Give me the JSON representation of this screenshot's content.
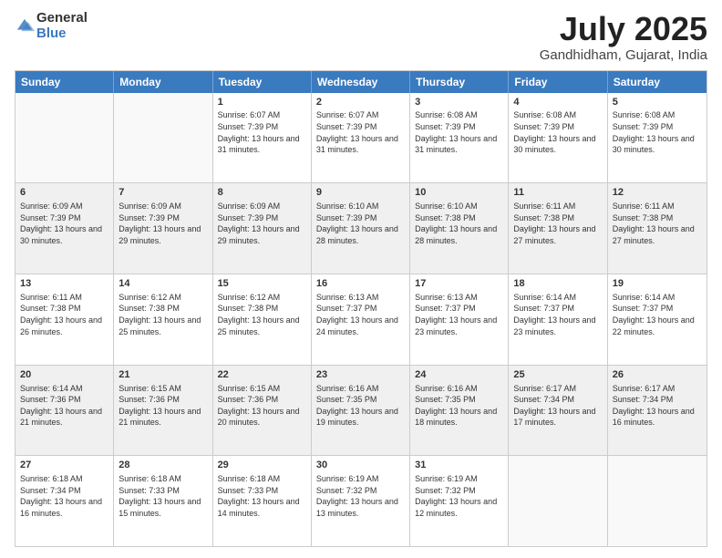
{
  "header": {
    "logo_general": "General",
    "logo_blue": "Blue",
    "title_month": "July 2025",
    "title_location": "Gandhidham, Gujarat, India"
  },
  "days_of_week": [
    "Sunday",
    "Monday",
    "Tuesday",
    "Wednesday",
    "Thursday",
    "Friday",
    "Saturday"
  ],
  "weeks": [
    [
      {
        "day": "",
        "sunrise": "",
        "sunset": "",
        "daylight": "",
        "empty": true
      },
      {
        "day": "",
        "sunrise": "",
        "sunset": "",
        "daylight": "",
        "empty": true
      },
      {
        "day": "1",
        "sunrise": "Sunrise: 6:07 AM",
        "sunset": "Sunset: 7:39 PM",
        "daylight": "Daylight: 13 hours and 31 minutes.",
        "empty": false
      },
      {
        "day": "2",
        "sunrise": "Sunrise: 6:07 AM",
        "sunset": "Sunset: 7:39 PM",
        "daylight": "Daylight: 13 hours and 31 minutes.",
        "empty": false
      },
      {
        "day": "3",
        "sunrise": "Sunrise: 6:08 AM",
        "sunset": "Sunset: 7:39 PM",
        "daylight": "Daylight: 13 hours and 31 minutes.",
        "empty": false
      },
      {
        "day": "4",
        "sunrise": "Sunrise: 6:08 AM",
        "sunset": "Sunset: 7:39 PM",
        "daylight": "Daylight: 13 hours and 30 minutes.",
        "empty": false
      },
      {
        "day": "5",
        "sunrise": "Sunrise: 6:08 AM",
        "sunset": "Sunset: 7:39 PM",
        "daylight": "Daylight: 13 hours and 30 minutes.",
        "empty": false
      }
    ],
    [
      {
        "day": "6",
        "sunrise": "Sunrise: 6:09 AM",
        "sunset": "Sunset: 7:39 PM",
        "daylight": "Daylight: 13 hours and 30 minutes.",
        "empty": false
      },
      {
        "day": "7",
        "sunrise": "Sunrise: 6:09 AM",
        "sunset": "Sunset: 7:39 PM",
        "daylight": "Daylight: 13 hours and 29 minutes.",
        "empty": false
      },
      {
        "day": "8",
        "sunrise": "Sunrise: 6:09 AM",
        "sunset": "Sunset: 7:39 PM",
        "daylight": "Daylight: 13 hours and 29 minutes.",
        "empty": false
      },
      {
        "day": "9",
        "sunrise": "Sunrise: 6:10 AM",
        "sunset": "Sunset: 7:39 PM",
        "daylight": "Daylight: 13 hours and 28 minutes.",
        "empty": false
      },
      {
        "day": "10",
        "sunrise": "Sunrise: 6:10 AM",
        "sunset": "Sunset: 7:38 PM",
        "daylight": "Daylight: 13 hours and 28 minutes.",
        "empty": false
      },
      {
        "day": "11",
        "sunrise": "Sunrise: 6:11 AM",
        "sunset": "Sunset: 7:38 PM",
        "daylight": "Daylight: 13 hours and 27 minutes.",
        "empty": false
      },
      {
        "day": "12",
        "sunrise": "Sunrise: 6:11 AM",
        "sunset": "Sunset: 7:38 PM",
        "daylight": "Daylight: 13 hours and 27 minutes.",
        "empty": false
      }
    ],
    [
      {
        "day": "13",
        "sunrise": "Sunrise: 6:11 AM",
        "sunset": "Sunset: 7:38 PM",
        "daylight": "Daylight: 13 hours and 26 minutes.",
        "empty": false
      },
      {
        "day": "14",
        "sunrise": "Sunrise: 6:12 AM",
        "sunset": "Sunset: 7:38 PM",
        "daylight": "Daylight: 13 hours and 25 minutes.",
        "empty": false
      },
      {
        "day": "15",
        "sunrise": "Sunrise: 6:12 AM",
        "sunset": "Sunset: 7:38 PM",
        "daylight": "Daylight: 13 hours and 25 minutes.",
        "empty": false
      },
      {
        "day": "16",
        "sunrise": "Sunrise: 6:13 AM",
        "sunset": "Sunset: 7:37 PM",
        "daylight": "Daylight: 13 hours and 24 minutes.",
        "empty": false
      },
      {
        "day": "17",
        "sunrise": "Sunrise: 6:13 AM",
        "sunset": "Sunset: 7:37 PM",
        "daylight": "Daylight: 13 hours and 23 minutes.",
        "empty": false
      },
      {
        "day": "18",
        "sunrise": "Sunrise: 6:14 AM",
        "sunset": "Sunset: 7:37 PM",
        "daylight": "Daylight: 13 hours and 23 minutes.",
        "empty": false
      },
      {
        "day": "19",
        "sunrise": "Sunrise: 6:14 AM",
        "sunset": "Sunset: 7:37 PM",
        "daylight": "Daylight: 13 hours and 22 minutes.",
        "empty": false
      }
    ],
    [
      {
        "day": "20",
        "sunrise": "Sunrise: 6:14 AM",
        "sunset": "Sunset: 7:36 PM",
        "daylight": "Daylight: 13 hours and 21 minutes.",
        "empty": false
      },
      {
        "day": "21",
        "sunrise": "Sunrise: 6:15 AM",
        "sunset": "Sunset: 7:36 PM",
        "daylight": "Daylight: 13 hours and 21 minutes.",
        "empty": false
      },
      {
        "day": "22",
        "sunrise": "Sunrise: 6:15 AM",
        "sunset": "Sunset: 7:36 PM",
        "daylight": "Daylight: 13 hours and 20 minutes.",
        "empty": false
      },
      {
        "day": "23",
        "sunrise": "Sunrise: 6:16 AM",
        "sunset": "Sunset: 7:35 PM",
        "daylight": "Daylight: 13 hours and 19 minutes.",
        "empty": false
      },
      {
        "day": "24",
        "sunrise": "Sunrise: 6:16 AM",
        "sunset": "Sunset: 7:35 PM",
        "daylight": "Daylight: 13 hours and 18 minutes.",
        "empty": false
      },
      {
        "day": "25",
        "sunrise": "Sunrise: 6:17 AM",
        "sunset": "Sunset: 7:34 PM",
        "daylight": "Daylight: 13 hours and 17 minutes.",
        "empty": false
      },
      {
        "day": "26",
        "sunrise": "Sunrise: 6:17 AM",
        "sunset": "Sunset: 7:34 PM",
        "daylight": "Daylight: 13 hours and 16 minutes.",
        "empty": false
      }
    ],
    [
      {
        "day": "27",
        "sunrise": "Sunrise: 6:18 AM",
        "sunset": "Sunset: 7:34 PM",
        "daylight": "Daylight: 13 hours and 16 minutes.",
        "empty": false
      },
      {
        "day": "28",
        "sunrise": "Sunrise: 6:18 AM",
        "sunset": "Sunset: 7:33 PM",
        "daylight": "Daylight: 13 hours and 15 minutes.",
        "empty": false
      },
      {
        "day": "29",
        "sunrise": "Sunrise: 6:18 AM",
        "sunset": "Sunset: 7:33 PM",
        "daylight": "Daylight: 13 hours and 14 minutes.",
        "empty": false
      },
      {
        "day": "30",
        "sunrise": "Sunrise: 6:19 AM",
        "sunset": "Sunset: 7:32 PM",
        "daylight": "Daylight: 13 hours and 13 minutes.",
        "empty": false
      },
      {
        "day": "31",
        "sunrise": "Sunrise: 6:19 AM",
        "sunset": "Sunset: 7:32 PM",
        "daylight": "Daylight: 13 hours and 12 minutes.",
        "empty": false
      },
      {
        "day": "",
        "sunrise": "",
        "sunset": "",
        "daylight": "",
        "empty": true
      },
      {
        "day": "",
        "sunrise": "",
        "sunset": "",
        "daylight": "",
        "empty": true
      }
    ]
  ]
}
